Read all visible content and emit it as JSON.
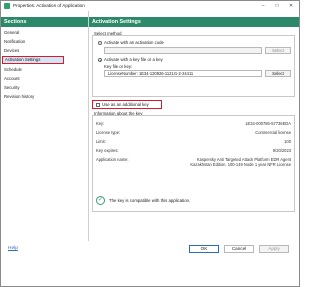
{
  "window": {
    "title": "Properties: Activation of Application"
  },
  "sidebar": {
    "header": "Sections",
    "items": [
      "General",
      "Notification",
      "Devices",
      "Activation Settings",
      "Schedule",
      "Account",
      "Security",
      "Revision history"
    ]
  },
  "main": {
    "header": "Activation Settings",
    "select_method": {
      "label": "Select method",
      "option_code": "Activate with an activation code",
      "select_button_1": "Select",
      "option_key": "Activate with a key file or a key",
      "key_label": "Key file or key:",
      "key_value": "LicenseNumber: 1E34-120926-1121I1-2-24411",
      "select_button_2": "Select"
    },
    "additional_key": "Use as an additional key",
    "info": {
      "label": "Information about the key",
      "rows": [
        {
          "key": "Key:",
          "value": "1E34-000786-57736EDA"
        },
        {
          "key": "License type:",
          "value": "Commercial license"
        },
        {
          "key": "Limit:",
          "value": "100"
        },
        {
          "key": "Key expires:",
          "value": "9/20/2023"
        },
        {
          "key": "Application name:",
          "value": "Kaspersky Anti Targeted Attack Platform EDR Agent Kazakhstan Edition. 100-149 Node 1 year NFR License"
        }
      ]
    },
    "compat_text": "The key is compatible with this application."
  },
  "footer": {
    "help": "Help",
    "ok": "OK",
    "cancel": "Cancel",
    "apply": "Apply"
  }
}
